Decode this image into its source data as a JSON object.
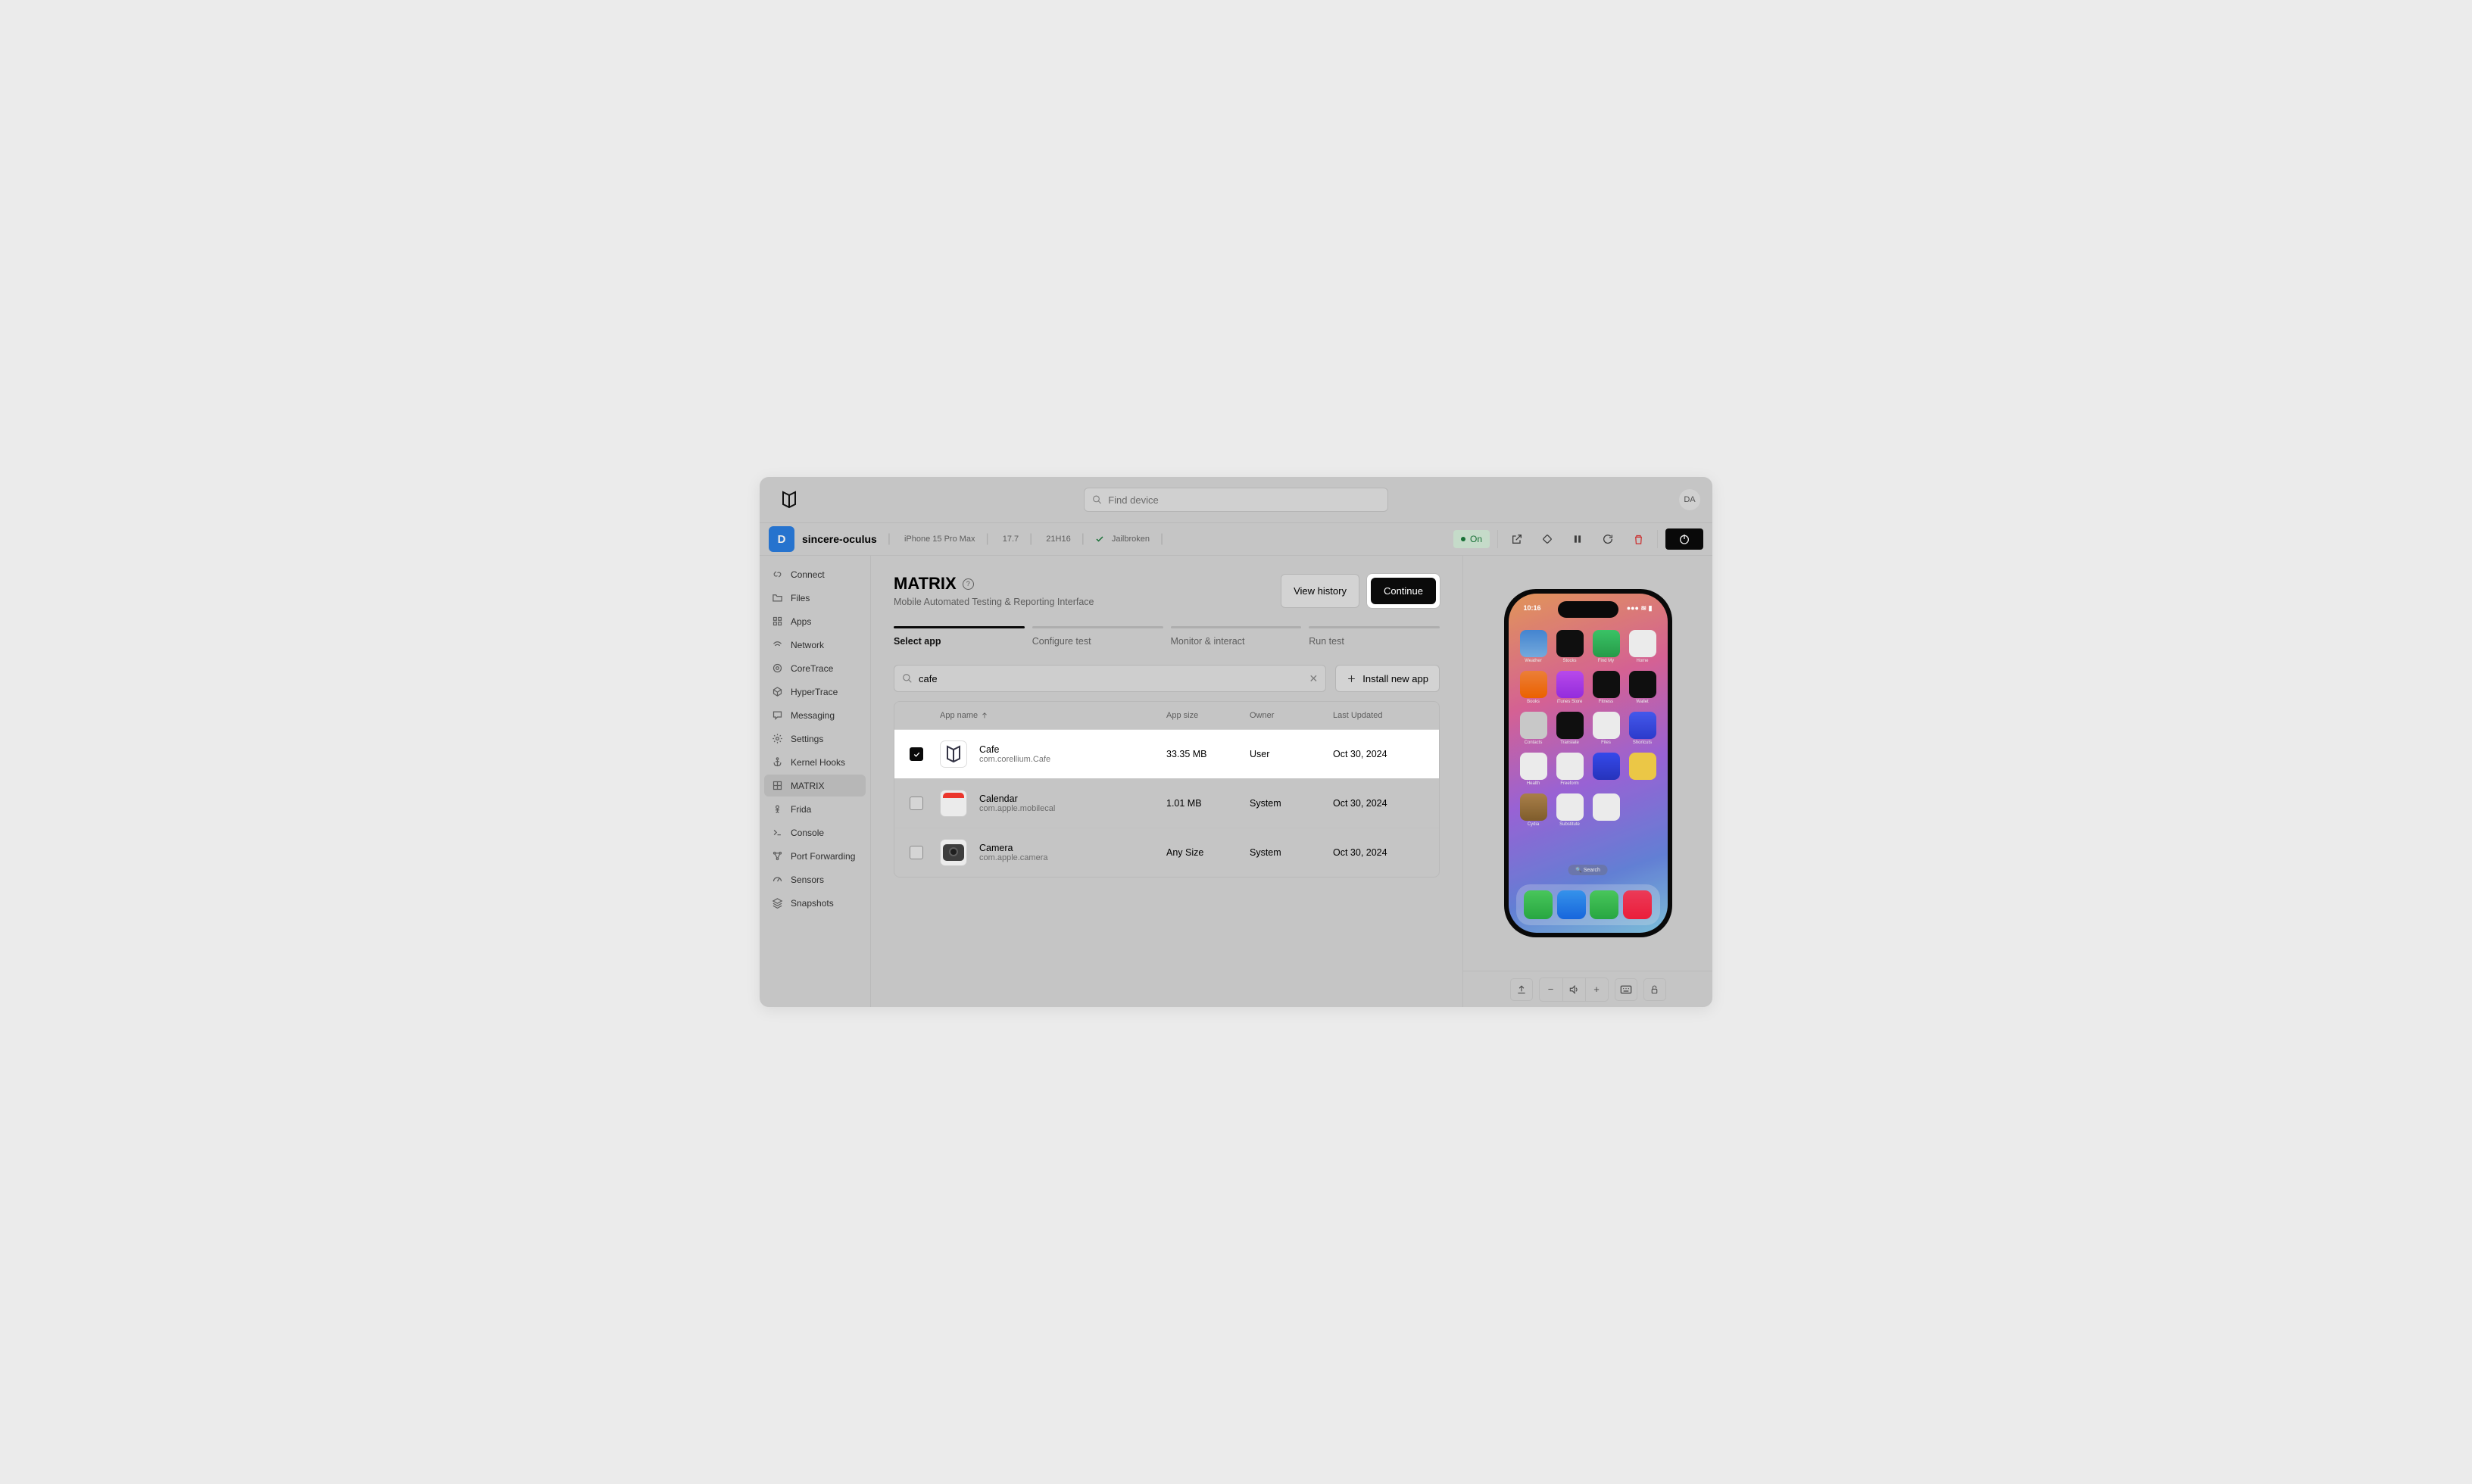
{
  "topbar": {
    "search_placeholder": "Find device",
    "avatar_initials": "DA"
  },
  "devicebar": {
    "initial": "D",
    "name": "sincere-oculus",
    "model": "iPhone 15 Pro Max",
    "os": "17.7",
    "build": "21H16",
    "jailbroken_label": "Jailbroken",
    "status_label": "On"
  },
  "sidebar": {
    "items": [
      {
        "label": "Connect",
        "icon": "link"
      },
      {
        "label": "Files",
        "icon": "folder"
      },
      {
        "label": "Apps",
        "icon": "grid"
      },
      {
        "label": "Network",
        "icon": "wifi"
      },
      {
        "label": "CoreTrace",
        "icon": "target"
      },
      {
        "label": "HyperTrace",
        "icon": "cube"
      },
      {
        "label": "Messaging",
        "icon": "message"
      },
      {
        "label": "Settings",
        "icon": "gear"
      },
      {
        "label": "Kernel Hooks",
        "icon": "anchor"
      },
      {
        "label": "MATRIX",
        "icon": "matrix",
        "active": true
      },
      {
        "label": "Frida",
        "icon": "frida"
      },
      {
        "label": "Console",
        "icon": "terminal"
      },
      {
        "label": "Port Forwarding",
        "icon": "nodes"
      },
      {
        "label": "Sensors",
        "icon": "gauge"
      },
      {
        "label": "Snapshots",
        "icon": "layers"
      }
    ]
  },
  "main": {
    "title": "MATRIX",
    "subtitle": "Mobile Automated Testing & Reporting Interface",
    "view_history_label": "View history",
    "continue_label": "Continue",
    "steps": [
      {
        "label": "Select app",
        "active": true
      },
      {
        "label": "Configure test"
      },
      {
        "label": "Monitor & interact"
      },
      {
        "label": "Run test"
      }
    ],
    "search_value": "cafe",
    "install_label": "Install new app",
    "columns": {
      "name": "App name",
      "size": "App size",
      "owner": "Owner",
      "updated": "Last Updated"
    },
    "rows": [
      {
        "checked": true,
        "name": "Cafe",
        "bundle": "com.corellium.Cafe",
        "size": "33.35 MB",
        "owner": "User",
        "updated": "Oct 30, 2024",
        "icon_svg": "logo",
        "highlighted": true
      },
      {
        "checked": false,
        "name": "Calendar",
        "bundle": "com.apple.mobilecal",
        "size": "1.01 MB",
        "owner": "System",
        "updated": "Oct 30, 2024",
        "icon_emoji": "calendar"
      },
      {
        "checked": false,
        "name": "Camera",
        "bundle": "com.apple.camera",
        "size": "Any Size",
        "owner": "System",
        "updated": "Oct 30, 2024",
        "icon_emoji": "camera"
      }
    ]
  },
  "phone": {
    "time": "10:16",
    "search_label": "Search",
    "home_apps": [
      {
        "lbl": "Weather",
        "bg": "linear-gradient(#4a90e2,#7eb8ef)"
      },
      {
        "lbl": "Stocks",
        "bg": "#111"
      },
      {
        "lbl": "Find My",
        "bg": "linear-gradient(#3fd46f,#2aa84f)"
      },
      {
        "lbl": "Home",
        "bg": "#fff"
      },
      {
        "lbl": "Books",
        "bg": "linear-gradient(#ff8a3d,#ff6a00)"
      },
      {
        "lbl": "iTunes Store",
        "bg": "linear-gradient(#c850ff,#a030ef)"
      },
      {
        "lbl": "Fitness",
        "bg": "#111"
      },
      {
        "lbl": "Wallet",
        "bg": "#111"
      },
      {
        "lbl": "Contacts",
        "bg": "#d9d9d9"
      },
      {
        "lbl": "Translate",
        "bg": "#111"
      },
      {
        "lbl": "Files",
        "bg": "#fff"
      },
      {
        "lbl": "Shortcuts",
        "bg": "linear-gradient(#4a60ff,#3040dd)"
      },
      {
        "lbl": "Health",
        "bg": "#fff"
      },
      {
        "lbl": "Freeform",
        "bg": "#fff"
      },
      {
        "lbl": "",
        "bg": "linear-gradient(#3a50ff,#2a38cc)"
      },
      {
        "lbl": "",
        "bg": "#ffd84d"
      },
      {
        "lbl": "Cydia",
        "bg": "linear-gradient(#b88a50,#8a6530)"
      },
      {
        "lbl": "Substitute",
        "bg": "#fff"
      },
      {
        "lbl": "",
        "bg": "#fff"
      }
    ],
    "dock": [
      {
        "bg": "linear-gradient(#4fd763,#2bb547)"
      },
      {
        "bg": "linear-gradient(#3a9fff,#1a6fef)"
      },
      {
        "bg": "linear-gradient(#4fd763,#2bb547)"
      },
      {
        "bg": "linear-gradient(#ff4060,#ff2040)"
      }
    ]
  }
}
